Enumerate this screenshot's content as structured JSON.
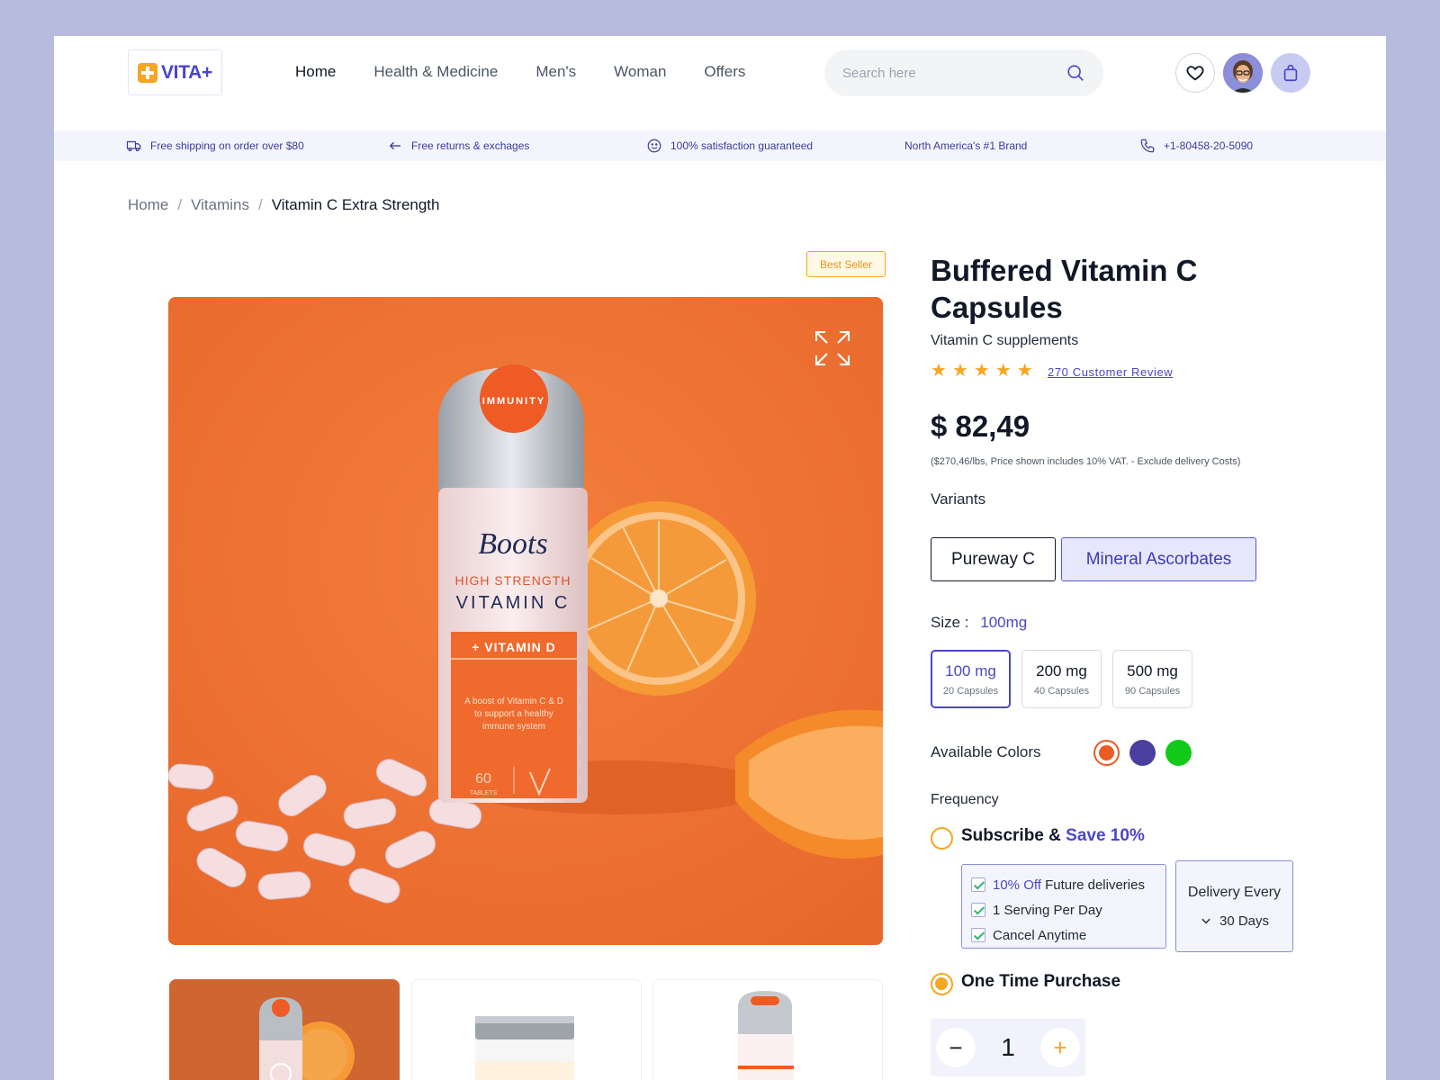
{
  "brand": {
    "name": "VITA+"
  },
  "nav": {
    "items": [
      "Home",
      "Health & Medicine",
      "Men's",
      "Woman",
      "Offers"
    ]
  },
  "search": {
    "placeholder": "Search here"
  },
  "strip": {
    "shipping": "Free shipping on order over $80",
    "returns": "Free returns & exchages",
    "satisfaction": "100% satisfaction guaranteed",
    "brand_claim": "North America's #1 Brand",
    "phone": "+1-80458-20-5090"
  },
  "breadcrumb": {
    "items": [
      "Home",
      "Vitamins",
      "Vitamin C Extra Strength"
    ],
    "separator": "/"
  },
  "product": {
    "badge": "Best Seller",
    "title": "Buffered Vitamin C Capsules",
    "subtitle": "Vitamin C supplements",
    "rating": 5,
    "reviews": "270 Customer Review",
    "price": "$ 82,49",
    "price_note": "($270,46/lbs, Price shown includes 10% VAT. - Exclude delivery Costs)",
    "image_text": {
      "cap": "IMMUNITY",
      "brand": "Boots",
      "line1": "HIGH STRENGTH",
      "line2": "VITAMIN C",
      "band": "+ VITAMIN D",
      "desc1": "A boost of Vitamin C & D",
      "desc2": "to support a healthy",
      "desc3": "immune system",
      "count": "60",
      "count_label": "TABLETS"
    }
  },
  "variants": {
    "label": "Variants",
    "items": [
      "Pureway C",
      "Mineral Ascorbates"
    ],
    "selected": "Mineral Ascorbates"
  },
  "size": {
    "label": "Size :",
    "selected": "100mg",
    "options": [
      {
        "mg": "100 mg",
        "caps": "20 Capsules"
      },
      {
        "mg": "200 mg",
        "caps": "40 Capsules"
      },
      {
        "mg": "500 mg",
        "caps": "90 Capsules"
      }
    ]
  },
  "colors": {
    "label": "Available Colors",
    "swatches": [
      "#ee5a24",
      "#4a3f9e",
      "#13c91a"
    ],
    "selected": "#ee5a24"
  },
  "frequency": {
    "label": "Frequency",
    "subscribe": "Subscribe &",
    "save": "Save 10%",
    "benefits": [
      {
        "highlight": "10% Off",
        "text": "Future deliveries"
      },
      {
        "highlight": "",
        "text": "1 Serving Per Day"
      },
      {
        "highlight": "",
        "text": "Cancel Anytime"
      }
    ],
    "delivery_title": "Delivery Every",
    "delivery_value": "30 Days",
    "one_time": "One Time Purchase",
    "selected": "One Time Purchase"
  },
  "quantity": {
    "value": "1",
    "minus": "−",
    "plus": "+"
  },
  "colors_ui": {
    "accent": "#4a46c9",
    "orange": "#f5a623",
    "image_bg": "#ee7131"
  }
}
